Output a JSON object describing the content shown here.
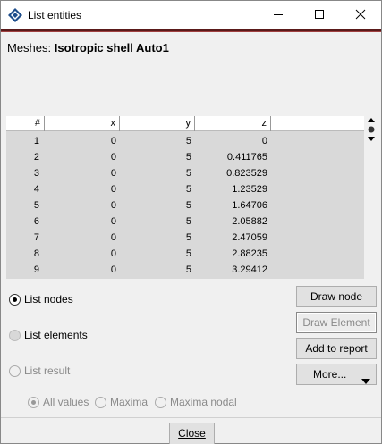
{
  "window": {
    "title": "List entities",
    "minimize_icon": "minimize-icon",
    "maximize_icon": "maximize-icon",
    "close_icon": "close-icon"
  },
  "meshes": {
    "label": "Meshes:",
    "value": "Isotropic shell Auto1"
  },
  "table": {
    "columns": [
      "#",
      "x",
      "y",
      "z"
    ],
    "rows": [
      [
        "1",
        "0",
        "5",
        "0"
      ],
      [
        "2",
        "0",
        "5",
        "0.411765"
      ],
      [
        "3",
        "0",
        "5",
        "0.823529"
      ],
      [
        "4",
        "0",
        "5",
        "1.23529"
      ],
      [
        "5",
        "0",
        "5",
        "1.64706"
      ],
      [
        "6",
        "0",
        "5",
        "2.05882"
      ],
      [
        "7",
        "0",
        "5",
        "2.47059"
      ],
      [
        "8",
        "0",
        "5",
        "2.88235"
      ],
      [
        "9",
        "0",
        "5",
        "3.29412"
      ]
    ]
  },
  "options": {
    "list_nodes": "List nodes",
    "list_elements": "List elements",
    "list_result": "List result",
    "all_values": "All values",
    "maxima": "Maxima",
    "maxima_nodal": "Maxima nodal"
  },
  "buttons": {
    "draw_node": "Draw node",
    "draw_element": "Draw Element",
    "add_to_report": "Add to report",
    "more": "More...",
    "close": "Close"
  },
  "colors": {
    "title_rule": "#5a1a1a",
    "table_bg": "#d9d9d9",
    "window_bg": "#f0f0f0"
  }
}
